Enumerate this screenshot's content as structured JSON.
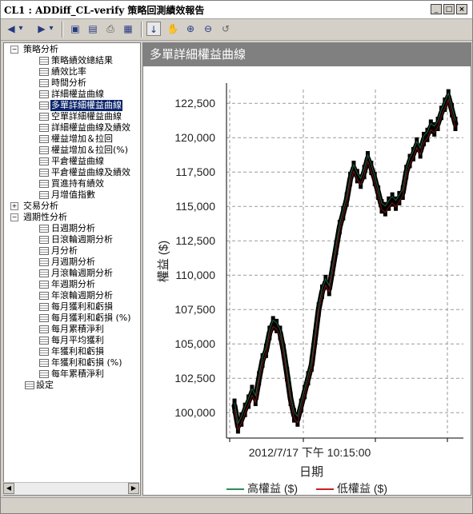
{
  "window": {
    "title": "CL1 : ADDiff_CL-verify 策略回測績效報告",
    "min_glyph": "_",
    "max_glyph": "□",
    "close_glyph": "×"
  },
  "toolbar": {
    "back_glyph": "◀",
    "forward_glyph": "▶",
    "dropdown_glyph": "▾",
    "save_glyph": "▣",
    "preview_glyph": "▤",
    "print_glyph": "⎙",
    "grid_glyph": "▦",
    "pointer_glyph": "↓",
    "hand_glyph": "✋",
    "zoomin_glyph": "⊕",
    "zoomout_glyph": "⊖",
    "undo_glyph": "↺"
  },
  "tree": {
    "groups": [
      {
        "label": "策略分析",
        "expanded": true,
        "items": [
          "策略績效總結果",
          "績效比率",
          "時間分析",
          "詳細權益曲線",
          "多單詳細權益曲線",
          "空單詳細權益曲線",
          "詳細權益曲線及績效",
          "權益增加＆拉回",
          "權益增加＆拉回(%)",
          "平倉權益曲線",
          "平倉權益曲線及績效",
          "買進持有績效",
          "月增值指數"
        ]
      },
      {
        "label": "交易分析",
        "expanded": false,
        "items": []
      },
      {
        "label": "週期性分析",
        "expanded": true,
        "items": [
          "日週期分析",
          "日滾輪週期分析",
          "月分析",
          "月週期分析",
          "月滾輪週期分析",
          "年週期分析",
          "年滾輪週期分析",
          "每月獲利和虧損",
          "每月獲利和虧損 (%)",
          "每月累積淨利",
          "每月平均獲利",
          "年獲利和虧損",
          "年獲利和虧損 (%)",
          "每年累積淨利"
        ]
      },
      {
        "label": "設定",
        "leaf": true
      }
    ],
    "selected": "多單詳細權益曲線"
  },
  "chart_header": "多單詳細權益曲線",
  "chart_data": {
    "type": "line",
    "title": "多單詳細權益曲線",
    "xlabel": "日期",
    "ylabel": "權益 ($)",
    "x_tick_label": "2012/7/17 下午 10:15:00",
    "ylim": [
      98500,
      123500
    ],
    "yticks": [
      "100,000",
      "102,500",
      "105,000",
      "107,500",
      "110,000",
      "112,500",
      "115,000",
      "117,500",
      "120,000",
      "122,500"
    ],
    "ytick_values": [
      100000,
      102500,
      105000,
      107500,
      110000,
      112500,
      115000,
      117500,
      120000,
      122500
    ],
    "grid": true,
    "legend_position": "bottom",
    "series": [
      {
        "name": "高權益 ($)",
        "color": "#2e8b57"
      },
      {
        "name": "低權益 ($)",
        "color": "#cc2020"
      }
    ],
    "equity": [
      100500,
      99000,
      99500,
      100200,
      100800,
      101500,
      101000,
      102500,
      103800,
      104500,
      105800,
      106500,
      106300,
      105800,
      104500,
      102800,
      101000,
      99800,
      99500,
      100500,
      101500,
      102500,
      103500,
      105500,
      107500,
      108800,
      109500,
      109000,
      110500,
      112000,
      113500,
      114500,
      115500,
      117000,
      117800,
      117200,
      116800,
      117500,
      118500,
      117800,
      117000,
      116000,
      115000,
      114800,
      115200,
      115500,
      115200,
      115600,
      116000,
      117500,
      118300,
      118800,
      119500,
      119000,
      119900,
      120200,
      120800,
      120600,
      121000,
      121800,
      122400,
      123000,
      122000,
      121000
    ]
  }
}
